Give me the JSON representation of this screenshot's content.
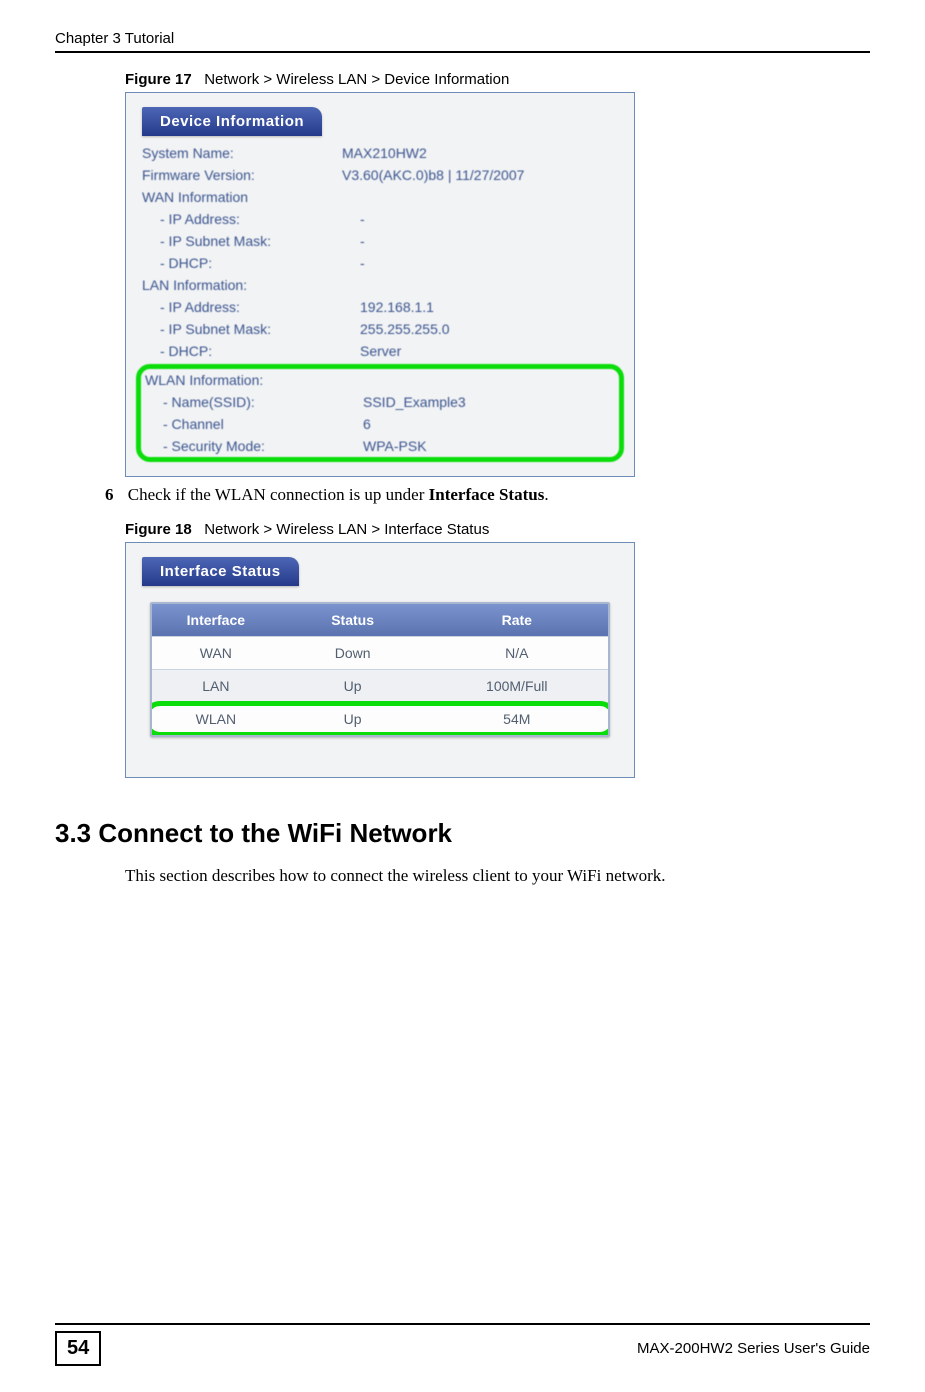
{
  "header": {
    "chapter": "Chapter 3 Tutorial"
  },
  "figure17": {
    "label": "Figure 17",
    "caption": "Network > Wireless LAN > Device Information",
    "panel_title": "Device Information",
    "rows": {
      "system_name_label": "System Name:",
      "system_name_value": "MAX210HW2",
      "firmware_label": "Firmware Version:",
      "firmware_value": "V3.60(AKC.0)b8 | 11/27/2007",
      "wan_header": "WAN Information",
      "wan_ip_label": "- IP Address:",
      "wan_ip_value": "-",
      "wan_mask_label": "- IP Subnet Mask:",
      "wan_mask_value": "-",
      "wan_dhcp_label": "- DHCP:",
      "wan_dhcp_value": "-",
      "lan_header": "LAN Information:",
      "lan_ip_label": "- IP Address:",
      "lan_ip_value": "192.168.1.1",
      "lan_mask_label": "- IP Subnet Mask:",
      "lan_mask_value": "255.255.255.0",
      "lan_dhcp_label": "- DHCP:",
      "lan_dhcp_value": "Server",
      "wlan_header": "WLAN Information:",
      "wlan_ssid_label": "- Name(SSID):",
      "wlan_ssid_value": "SSID_Example3",
      "wlan_channel_label": "- Channel",
      "wlan_channel_value": "6",
      "wlan_sec_label": "- Security Mode:",
      "wlan_sec_value": "WPA-PSK"
    }
  },
  "step6": {
    "num": "6",
    "text_before": "Check if the WLAN connection is up under ",
    "bold": "Interface Status",
    "text_after": "."
  },
  "figure18": {
    "label": "Figure 18",
    "caption": "Network > Wireless LAN > Interface Status",
    "panel_title": "Interface Status",
    "head": {
      "c1": "Interface",
      "c2": "Status",
      "c3": "Rate"
    },
    "rows": [
      {
        "c1": "WAN",
        "c2": "Down",
        "c3": "N/A"
      },
      {
        "c1": "LAN",
        "c2": "Up",
        "c3": "100M/Full"
      },
      {
        "c1": "WLAN",
        "c2": "Up",
        "c3": "54M"
      }
    ]
  },
  "section": {
    "heading": "3.3  Connect to the WiFi Network",
    "body": "This section describes how to connect the wireless client to your WiFi network."
  },
  "footer": {
    "page_number": "54",
    "guide": "MAX-200HW2 Series User's Guide"
  }
}
